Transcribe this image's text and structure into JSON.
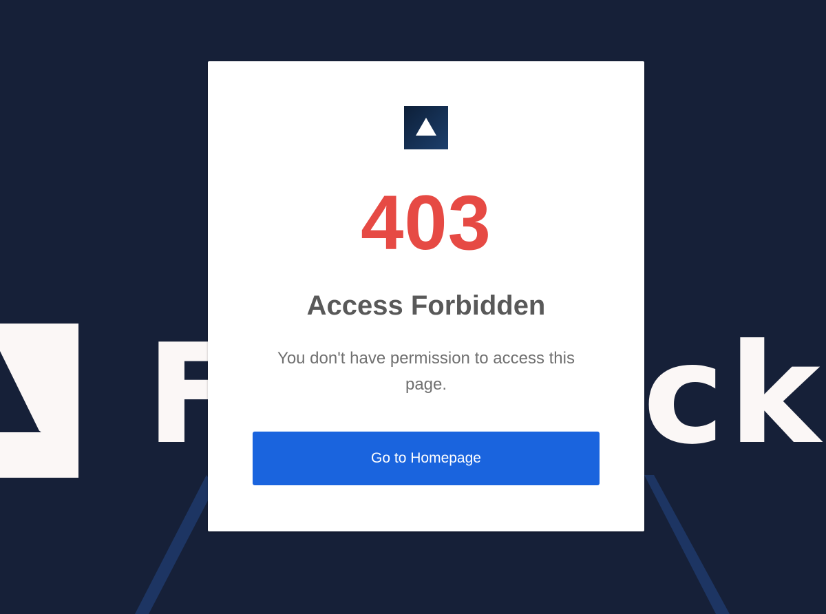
{
  "page": {
    "background_color": "#162038"
  },
  "background": {
    "logo_icon": "triangle-icon",
    "wordmark_left": "F",
    "wordmark_right": "ck",
    "wordmark_color": "#fbf7f6",
    "outline_color": "#1d3563"
  },
  "card": {
    "logo_icon": "triangle-icon",
    "error_code": "403",
    "error_code_color": "#e64a44",
    "title": "Access Forbidden",
    "message": "You don't have permission to access this page.",
    "button_label": "Go to Homepage",
    "button_color": "#1a64de"
  }
}
